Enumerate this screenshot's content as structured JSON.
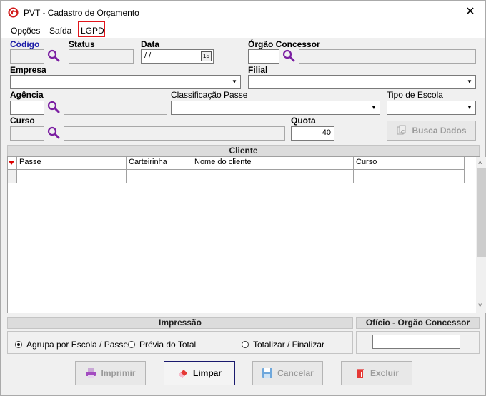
{
  "window": {
    "title": "PVT - Cadastro de Orçamento"
  },
  "menu": {
    "items": [
      "Opções",
      "Saída",
      "LGPD"
    ]
  },
  "form": {
    "codigo_label": "Código",
    "status_label": "Status",
    "data_label": "Data",
    "data_value": " /  /",
    "data_btn": "15",
    "orgao_label": "Órgão Concessor",
    "empresa_label": "Empresa",
    "filial_label": "Filial",
    "agencia_label": "Agência",
    "classificacao_label": "Classificação Passe",
    "tipo_escola_label": "Tipo de Escola",
    "curso_label": "Curso",
    "quota_label": "Quota",
    "quota_value": "40",
    "busca_dados_label": "Busca Dados"
  },
  "cliente": {
    "header": "Cliente",
    "columns": [
      "Passe",
      "Carteirinha",
      "Nome do cliente",
      "Curso"
    ]
  },
  "impressao": {
    "header": "Impressão",
    "options": [
      "Agrupa por Escola / Passe",
      "Prévia do Total",
      "Totalizar / Finalizar"
    ],
    "selected": "Agrupa por Escola / Passe"
  },
  "oficio": {
    "header": "Ofício - Orgão Concessor"
  },
  "buttons": {
    "imprimir": "Imprimir",
    "limpar": "Limpar",
    "cancelar": "Cancelar",
    "excluir": "Excluir"
  },
  "colors": {
    "accent_blue": "#1a1aa6",
    "highlight_red": "#e1161c",
    "search_purple": "#7b1fa2"
  }
}
